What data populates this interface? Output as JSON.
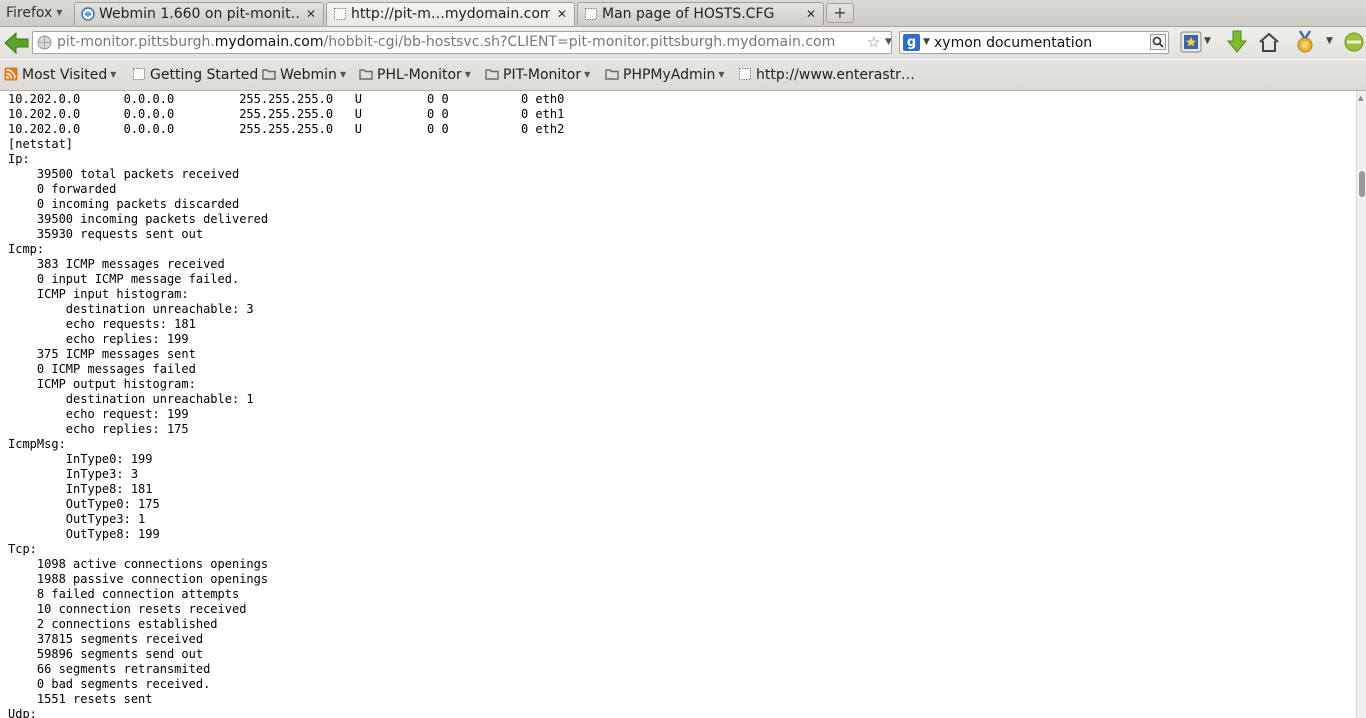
{
  "app": {
    "menu_label": "Firefox"
  },
  "tabs": [
    {
      "label": "Webmin 1.660 on pit-monit…",
      "icon": "webmin-icon",
      "active": false
    },
    {
      "label": "http://pit-m…mydomain.com",
      "icon": "blank-page-icon",
      "active": true
    },
    {
      "label": "Man page of HOSTS.CFG",
      "icon": "blank-page-icon",
      "active": false
    }
  ],
  "new_tab_label": "+",
  "tab_close_glyph": "✕",
  "url": {
    "prefix": "pit-monitor.pittsburgh.",
    "domain": "mydomain.com",
    "suffix": "/hobbit-cgi/bb-hostsvc.sh?CLIENT=pit-monitor.pittsburgh.mydomain.com"
  },
  "search": {
    "value": "xymon documentation",
    "engine_letter": "g"
  },
  "bookmarks": [
    {
      "label": "Most Visited",
      "icon": "rss-feed-icon",
      "dropdown": true
    },
    {
      "label": "Getting Started",
      "icon": "blank-page-icon",
      "dropdown": false
    },
    {
      "label": "Webmin",
      "icon": "folder-icon",
      "dropdown": true
    },
    {
      "label": "PHL-Monitor",
      "icon": "folder-icon",
      "dropdown": true
    },
    {
      "label": "PIT-Monitor",
      "icon": "folder-icon",
      "dropdown": true
    },
    {
      "label": "PHPMyAdmin",
      "icon": "folder-icon",
      "dropdown": true
    },
    {
      "label": "http://www.enterastr…",
      "icon": "blank-page-icon",
      "dropdown": false
    }
  ],
  "report_lines": [
    "10.202.0.0      0.0.0.0         255.255.255.0   U         0 0          0 eth0",
    "10.202.0.0      0.0.0.0         255.255.255.0   U         0 0          0 eth1",
    "10.202.0.0      0.0.0.0         255.255.255.0   U         0 0          0 eth2",
    "[netstat]",
    "Ip:",
    "    39500 total packets received",
    "    0 forwarded",
    "    0 incoming packets discarded",
    "    39500 incoming packets delivered",
    "    35930 requests sent out",
    "Icmp:",
    "    383 ICMP messages received",
    "    0 input ICMP message failed.",
    "    ICMP input histogram:",
    "        destination unreachable: 3",
    "        echo requests: 181",
    "        echo replies: 199",
    "    375 ICMP messages sent",
    "    0 ICMP messages failed",
    "    ICMP output histogram:",
    "        destination unreachable: 1",
    "        echo request: 199",
    "        echo replies: 175",
    "IcmpMsg:",
    "        InType0: 199",
    "        InType3: 3",
    "        InType8: 181",
    "        OutType0: 175",
    "        OutType3: 1",
    "        OutType8: 199",
    "Tcp:",
    "    1098 active connections openings",
    "    1988 passive connection openings",
    "    8 failed connection attempts",
    "    10 connection resets received",
    "    2 connections established",
    "    37815 segments received",
    "    59896 segments send out",
    "    66 segments retransmited",
    "    0 bad segments received.",
    "    1551 resets sent",
    "Udp:"
  ],
  "colors": {
    "back_arrow": "#5fa12b",
    "download_arrow": "#7cbd2f",
    "folder": "#6b6a66",
    "rss": "#e07b1a"
  }
}
